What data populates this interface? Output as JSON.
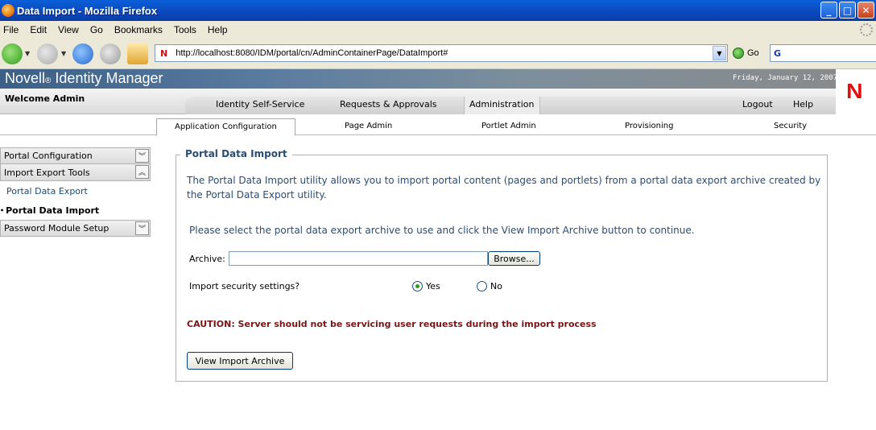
{
  "window": {
    "title": "Data Import - Mozilla Firefox",
    "controls": [
      "minimize",
      "maximize",
      "close"
    ]
  },
  "menubar": {
    "items": [
      "File",
      "Edit",
      "View",
      "Go",
      "Bookmarks",
      "Tools",
      "Help"
    ]
  },
  "toolbar": {
    "url": "http://localhost:8080/IDM/portal/cn/AdminContainerPage/DataImport#",
    "go_label": "Go",
    "search_glyph": "G"
  },
  "header": {
    "brand": "Novell",
    "brand_mark": "®",
    "product": "Identity Manager",
    "date": "Friday, January 12, 2007",
    "logo_letter": "N"
  },
  "nav": {
    "welcome": "Welcome Admin",
    "main_tabs": [
      "Identity Self-Service",
      "Requests & Approvals",
      "Administration"
    ],
    "active_main_tab": "Administration",
    "right_links": [
      "Logout",
      "Help"
    ],
    "sub_tabs": [
      "Application Configuration",
      "Page Admin",
      "Portlet Admin",
      "Provisioning",
      "Security"
    ],
    "active_sub_tab": "Application Configuration"
  },
  "sidebar": {
    "groups": [
      {
        "label": "Portal Configuration",
        "state": "collapsed"
      },
      {
        "label": "Import Export Tools",
        "state": "expanded"
      },
      {
        "label": "Password Module Setup",
        "state": "collapsed"
      }
    ],
    "links": [
      "Portal Data Export",
      "Portal Data Import"
    ],
    "current_link": "Portal Data Import"
  },
  "content": {
    "legend": "Portal Data Import",
    "description": "The Portal Data Import utility allows you to import portal content (pages and portlets) from a portal data export archive created by the Portal Data Export utility.",
    "instruction": "Please select the portal data export archive to use and click the View Import Archive button to continue.",
    "archive_label": "Archive:",
    "archive_value": "",
    "browse_label": "Browse...",
    "security_label": "Import security settings?",
    "radio_yes": "Yes",
    "radio_no": "No",
    "security_selected": "Yes",
    "caution": "CAUTION: Server should not be servicing user requests during the import process",
    "view_button": "View Import Archive"
  }
}
